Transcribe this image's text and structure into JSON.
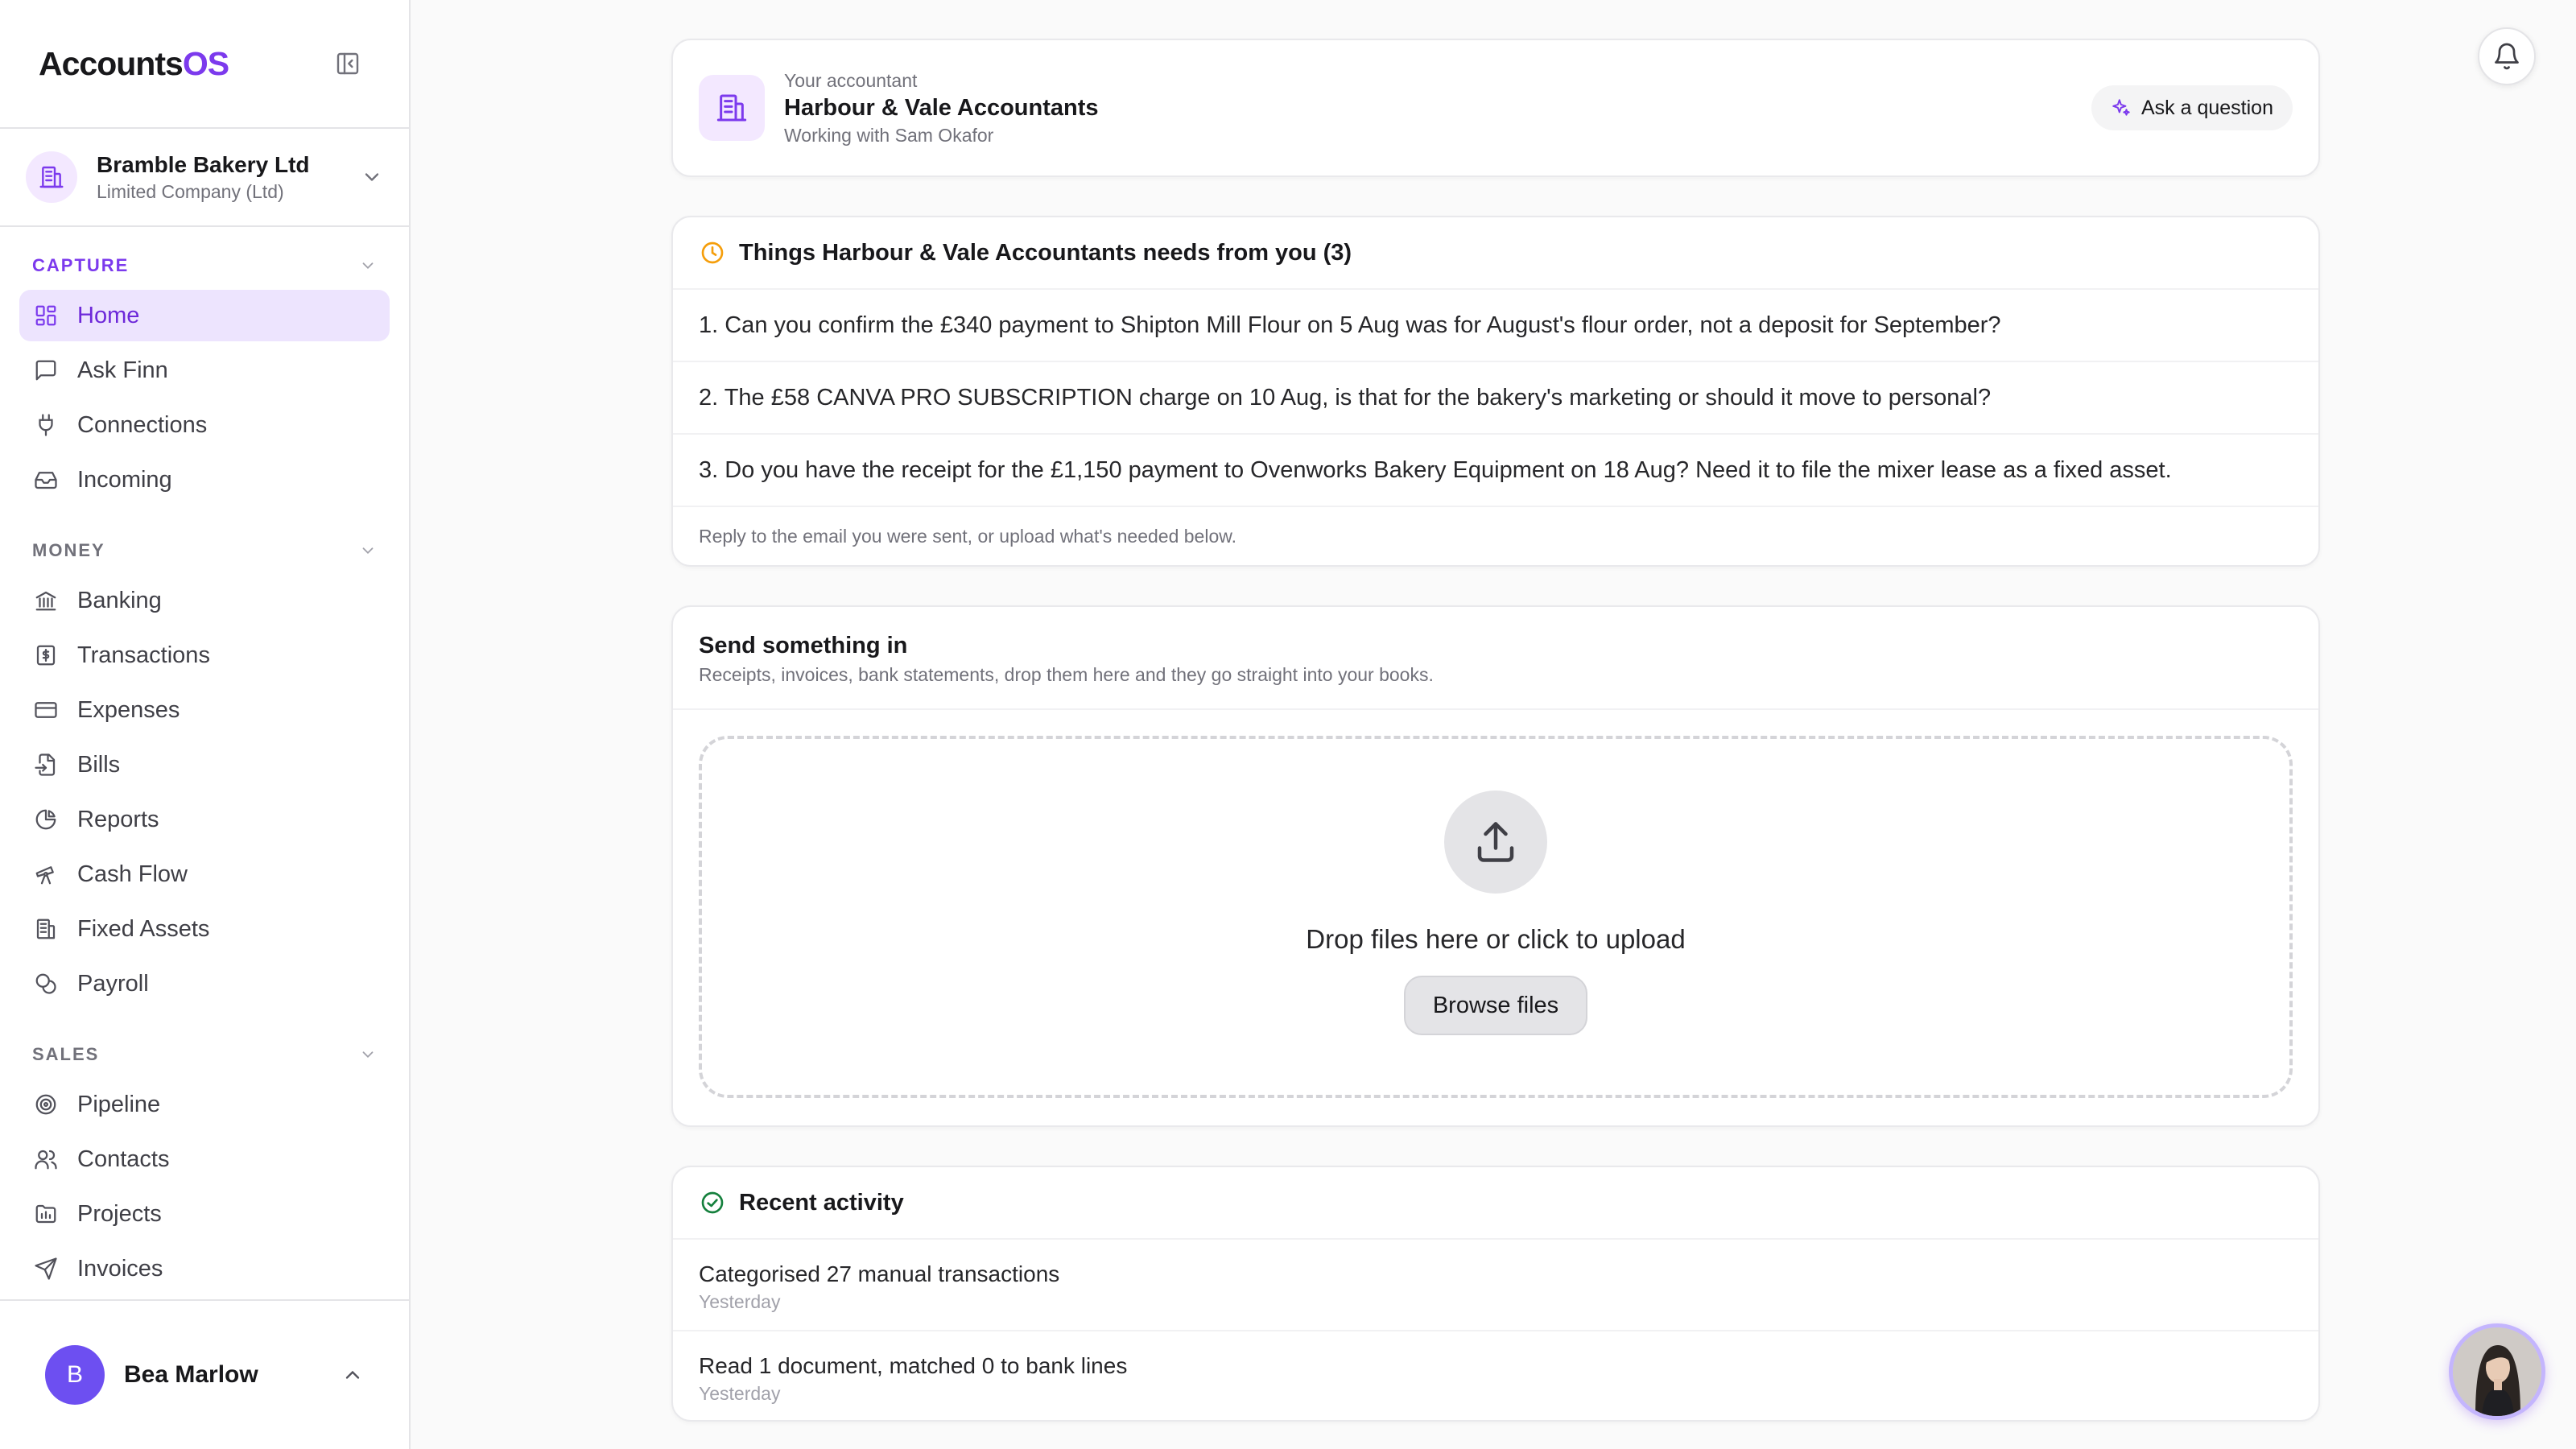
{
  "brand": {
    "name_main": "Accounts",
    "name_accent": "OS"
  },
  "company": {
    "name": "Bramble Bakery Ltd",
    "type": "Limited Company (Ltd)"
  },
  "nav": {
    "sections": [
      {
        "title": "CAPTURE",
        "items": [
          {
            "label": "Home",
            "icon": "grid-icon",
            "active": true
          },
          {
            "label": "Ask Finn",
            "icon": "chat-icon"
          },
          {
            "label": "Connections",
            "icon": "plug-icon"
          },
          {
            "label": "Incoming",
            "icon": "inbox-icon"
          }
        ]
      },
      {
        "title": "MONEY",
        "items": [
          {
            "label": "Banking",
            "icon": "bank-icon"
          },
          {
            "label": "Transactions",
            "icon": "receipt-icon"
          },
          {
            "label": "Expenses",
            "icon": "card-icon"
          },
          {
            "label": "Bills",
            "icon": "file-import-icon"
          },
          {
            "label": "Reports",
            "icon": "pie-chart-icon"
          },
          {
            "label": "Cash Flow",
            "icon": "telescope-icon"
          },
          {
            "label": "Fixed Assets",
            "icon": "building-icon"
          },
          {
            "label": "Payroll",
            "icon": "coins-icon"
          }
        ]
      },
      {
        "title": "SALES",
        "items": [
          {
            "label": "Pipeline",
            "icon": "target-icon"
          },
          {
            "label": "Contacts",
            "icon": "users-icon"
          },
          {
            "label": "Projects",
            "icon": "folder-icon"
          },
          {
            "label": "Invoices",
            "icon": "send-icon"
          }
        ]
      }
    ]
  },
  "user": {
    "initial": "B",
    "name": "Bea Marlow"
  },
  "accountant": {
    "eyebrow": "Your accountant",
    "name": "Harbour & Vale Accountants",
    "working_with": "Working with Sam Okafor",
    "ask_label": "Ask a question"
  },
  "needs": {
    "title": "Things Harbour & Vale Accountants needs from you (3)",
    "questions": [
      "1. Can you confirm the £340 payment to Shipton Mill Flour on 5 Aug was for August's flour order, not a deposit for September?",
      "2. The £58 CANVA PRO SUBSCRIPTION charge on 10 Aug, is that for the bakery's marketing or should it move to personal?",
      "3. Do you have the receipt for the £1,150 payment to Ovenworks Bakery Equipment on 18 Aug? Need it to file the mixer lease as a fixed asset."
    ],
    "footer": "Reply to the email you were sent, or upload what's needed below."
  },
  "send": {
    "title": "Send something in",
    "subtitle": "Receipts, invoices, bank statements, drop them here and they go straight into your books.",
    "drop_label": "Drop files here or click to upload",
    "browse_label": "Browse files"
  },
  "activity": {
    "title": "Recent activity",
    "items": [
      {
        "text": "Categorised 27 manual transactions",
        "time": "Yesterday"
      },
      {
        "text": "Read 1 document, matched 0 to bank lines",
        "time": "Yesterday"
      }
    ]
  },
  "colors": {
    "accent": "#7c3aed",
    "active_bg": "#ede4fe",
    "warning": "#f59e0b",
    "success": "#15803d"
  }
}
